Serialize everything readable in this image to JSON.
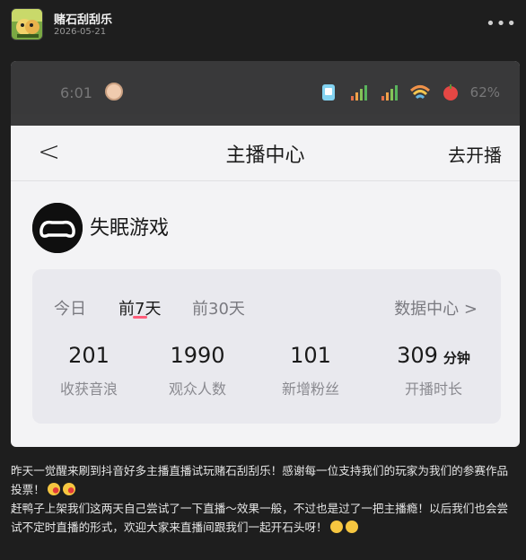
{
  "post": {
    "author": "赌石刮刮乐",
    "date": "2026-05-21",
    "more_glyph": "•••"
  },
  "screenshot": {
    "status_time": "6:01",
    "battery": "62%",
    "nav_back_glyph": "<",
    "nav_title": "主播中心",
    "nav_action": "去开播",
    "channel_name": "失眠游戏",
    "tabs": [
      {
        "label": "今日",
        "active": false
      },
      {
        "label": "前7天",
        "active": true
      },
      {
        "label": "前30天",
        "active": false
      }
    ],
    "data_center": "数据中心 >",
    "metrics": [
      {
        "value": "201",
        "unit": "",
        "label": "收获音浪"
      },
      {
        "value": "1990",
        "unit": "",
        "label": "观众人数"
      },
      {
        "value": "101",
        "unit": "",
        "label": "新增粉丝"
      },
      {
        "value": "309",
        "unit": "分钟",
        "label": "开播时长"
      }
    ]
  },
  "caption": {
    "line1": "昨天一觉醒来刷到抖音好多主播直播试玩赌石刮刮乐！感谢每一位支持我们的玩家为我们的参赛作品投票！",
    "line2": "赶鸭子上架我们这两天自己尝试了一下直播～效果一般，不过也是过了一把主播瘾！以后我们也会尝试不定时直播的形式，欢迎大家来直播间跟我们一起开石头呀！"
  },
  "colors": {
    "page_bg": "#1e1e1e",
    "tab_accent": "#fe5c7a",
    "shot_bg": "#f3f3f5"
  }
}
